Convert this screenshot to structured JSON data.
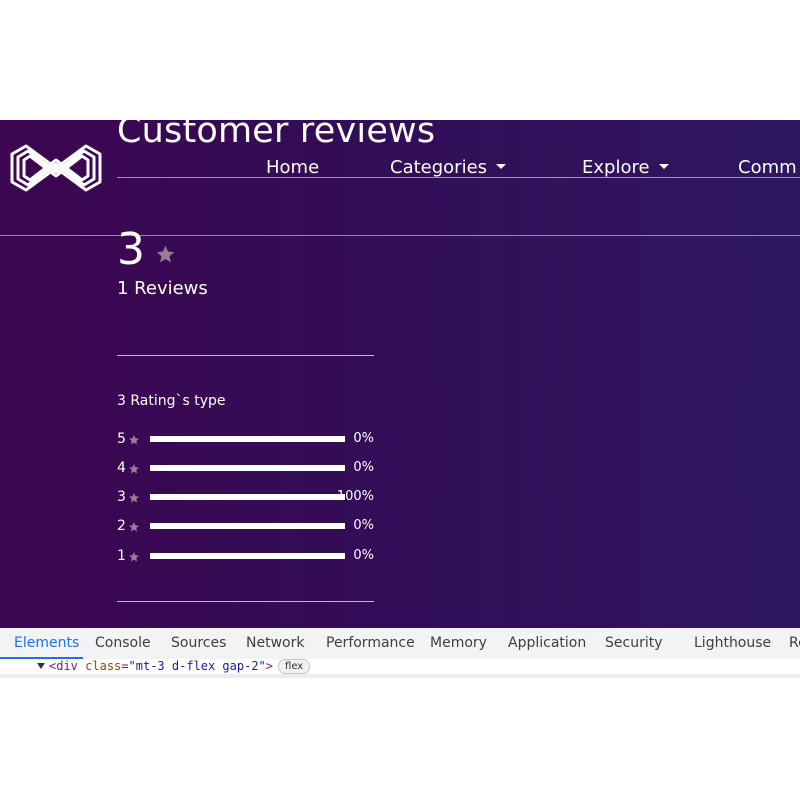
{
  "header": {
    "title": "Customer reviews",
    "nav": [
      {
        "label": "Home",
        "dropdown": false
      },
      {
        "label": "Categories",
        "dropdown": true
      },
      {
        "label": "Explore",
        "dropdown": true
      },
      {
        "label": "Comm",
        "dropdown": false
      }
    ]
  },
  "summary": {
    "rating": "3",
    "reviews_text": "1 Reviews"
  },
  "breakdown": {
    "label": "3 Rating`s type",
    "rows": [
      {
        "stars": "5",
        "percent": "0%",
        "fraction": 0
      },
      {
        "stars": "4",
        "percent": "0%",
        "fraction": 0
      },
      {
        "stars": "3",
        "percent": "100%",
        "fraction": 1
      },
      {
        "stars": "2",
        "percent": "0%",
        "fraction": 0
      },
      {
        "stars": "1",
        "percent": "0%",
        "fraction": 0
      }
    ]
  },
  "devtools": {
    "tabs": [
      "Elements",
      "Console",
      "Sources",
      "Network",
      "Performance",
      "Memory",
      "Application",
      "Security",
      "Lighthouse",
      "Re"
    ],
    "active_tab": "Elements",
    "code": {
      "open": "<",
      "tag": "div",
      "attr": "class",
      "eq": "=",
      "value": "\"mt-3 d-flex gap-2\"",
      "close": ">",
      "badge": "flex"
    }
  },
  "colors": {
    "bg_left": "#3d0650",
    "bg_right": "#2e1760",
    "star": "#9a7a96",
    "text": "#ffffff",
    "devtools_accent": "#1a73e8"
  },
  "icons": {
    "logo": "infinity-logo",
    "star": "star-icon",
    "caret": "caret-down-icon",
    "expand": "triangle-down-icon"
  }
}
